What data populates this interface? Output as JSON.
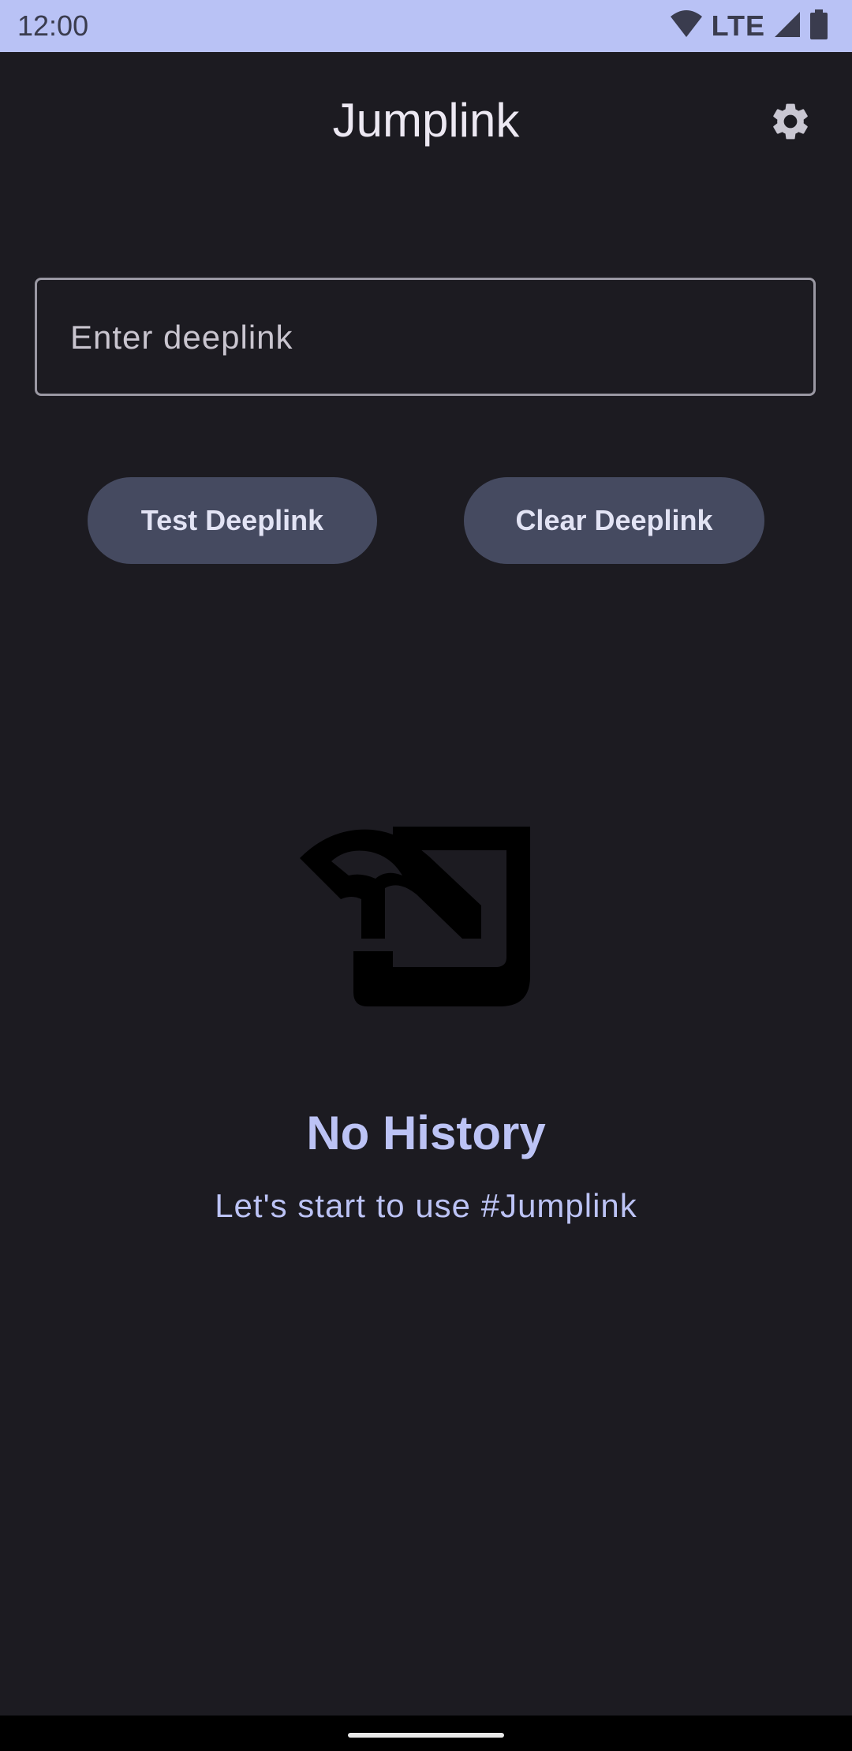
{
  "status_bar": {
    "time": "12:00",
    "network_label": "LTE",
    "icons": [
      "wifi-icon",
      "cellular-signal-icon",
      "battery-icon"
    ]
  },
  "app_bar": {
    "title": "Jumplink",
    "settings_icon": "gear-icon"
  },
  "deeplink_input": {
    "placeholder": "Enter deeplink",
    "value": ""
  },
  "actions": {
    "test_label": "Test Deeplink",
    "clear_label": "Clear Deeplink"
  },
  "empty_state": {
    "icon": "history-empty-icon",
    "title": "No History",
    "subtitle": "Let's start to use #Jumplink"
  },
  "colors": {
    "status_bar_bg": "#b9c2f5",
    "background": "#1c1b21",
    "button_bg": "#454a60",
    "accent_text": "#bcc3f5"
  }
}
